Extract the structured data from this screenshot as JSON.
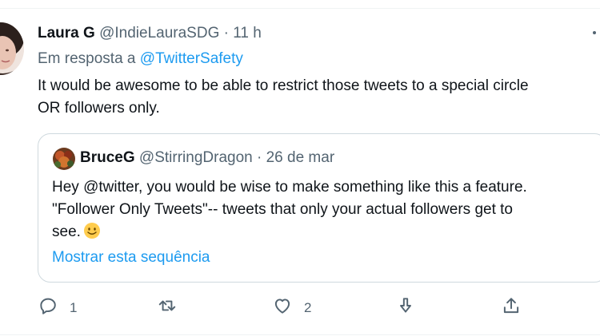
{
  "tweet": {
    "author_name": "Laura G",
    "author_handle": "@IndieLauraSDG",
    "separator": "·",
    "time": "11 h",
    "reply_prefix": "Em resposta a",
    "reply_mention": "@TwitterSafety",
    "text_line1": "It would be awesome to be able to restrict those tweets to a special circle",
    "text_line2": "OR followers only."
  },
  "quote": {
    "author_name": "BruceG",
    "author_handle": "@StirringDragon",
    "separator": "·",
    "date": "26 de mar",
    "line1": "Hey @twitter,  you would be wise to make something like this a feature.",
    "line2": "\"Follower Only Tweets\"-- tweets that only your actual followers get to",
    "line3": "see.",
    "show_thread": "Mostrar esta sequência"
  },
  "actions": {
    "reply_count": "1",
    "like_count": "2"
  },
  "icons": [
    "reply-icon",
    "retweet-icon",
    "like-icon",
    "bookmark-icon",
    "share-icon",
    "smile-emoji-icon",
    "more-icon"
  ],
  "colors": {
    "accent": "#1d9bf0",
    "muted": "#536471",
    "text": "#0f1419",
    "border": "#cfd9de"
  }
}
